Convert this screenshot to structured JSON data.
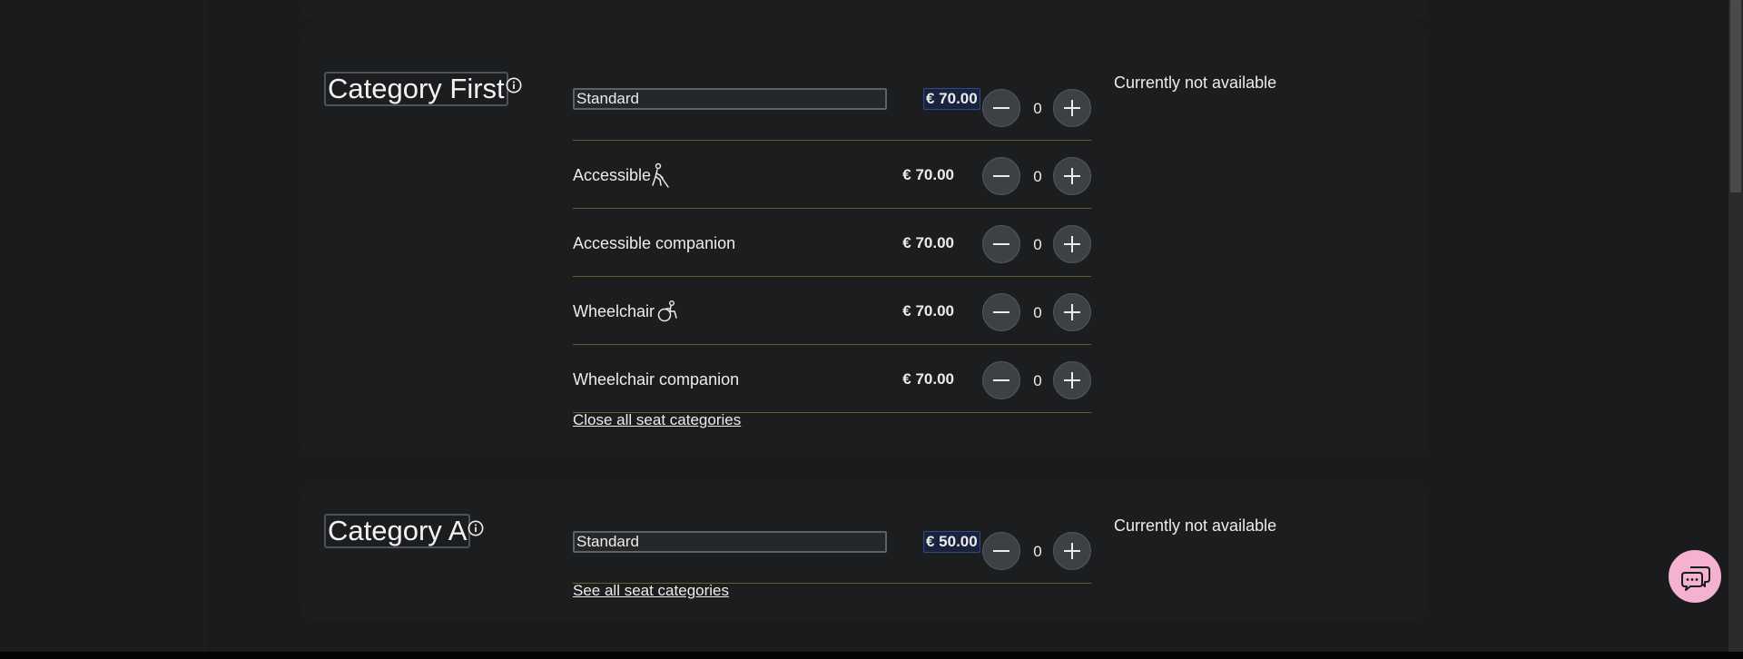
{
  "categories": [
    {
      "title": "Category First",
      "availability": "Currently not available",
      "rows": [
        {
          "label": "Standard",
          "price": "€ 70.00",
          "qty": "0",
          "icon": ""
        },
        {
          "label": "Accessible",
          "price": "€ 70.00",
          "qty": "0",
          "icon": "blind-person-icon"
        },
        {
          "label": "Accessible companion",
          "price": "€ 70.00",
          "qty": "0",
          "icon": ""
        },
        {
          "label": "Wheelchair",
          "price": "€ 70.00",
          "qty": "0",
          "icon": "wheelchair-icon"
        },
        {
          "label": "Wheelchair companion",
          "price": "€ 70.00",
          "qty": "0",
          "icon": ""
        }
      ],
      "toggle_link": "Close all seat categories"
    },
    {
      "title": "Category A",
      "availability": "Currently not available",
      "rows": [
        {
          "label": "Standard",
          "price": "€ 50.00",
          "qty": "0",
          "icon": ""
        }
      ],
      "toggle_link": "See all seat categories"
    }
  ],
  "icons": {
    "info": "info-icon",
    "minus": "minus-icon",
    "plus": "plus-icon",
    "chat": "chat-bubble-icon"
  },
  "colors": {
    "background": "#1a1b1c",
    "card": "#1c1d1f",
    "divider": "#6b5d28",
    "price_highlight": "#19233f",
    "chat_button": "#f5b2d0"
  }
}
